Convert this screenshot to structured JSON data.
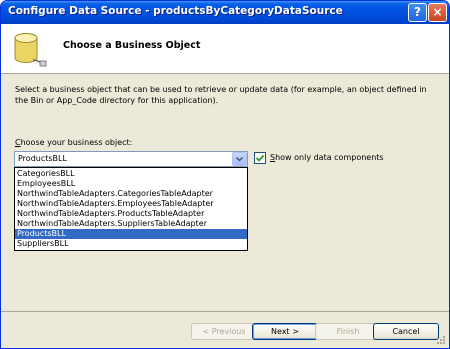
{
  "window": {
    "title": "Configure Data Source - productsByCategoryDataSource",
    "help_glyph": "?",
    "close_glyph": "×"
  },
  "header": {
    "title": "Choose a Business Object",
    "icon": "database-icon"
  },
  "description": "Select a business object that can be used to retrieve or update data (for example, an object defined in the Bin or App_Code directory for this application).",
  "business_object": {
    "label": "Choose your business object:",
    "selected_value": "ProductsBLL",
    "options": [
      "CategoriesBLL",
      "EmployeesBLL",
      "NorthwindTableAdapters.CategoriesTableAdapter",
      "NorthwindTableAdapters.EmployeesTableAdapter",
      "NorthwindTableAdapters.ProductsTableAdapter",
      "NorthwindTableAdapters.SuppliersTableAdapter",
      "ProductsBLL",
      "SuppliersBLL"
    ],
    "highlighted_option": "ProductsBLL"
  },
  "show_only_data_components": {
    "label": "Show only data components",
    "checked": true
  },
  "buttons": {
    "previous": "< Previous",
    "next": "Next >",
    "finish": "Finish",
    "cancel": "Cancel"
  },
  "colors": {
    "title_bar": "#0054e3",
    "selection": "#316ac5",
    "dialog_bg": "#ece9d8"
  }
}
